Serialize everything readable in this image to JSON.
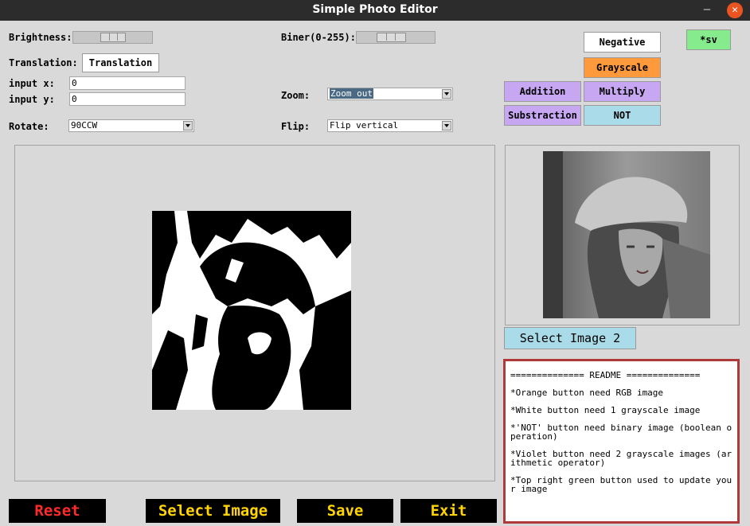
{
  "window": {
    "title": "Simple Photo Editor",
    "minimize_glyph": "–",
    "close_glyph": "✕"
  },
  "controls": {
    "brightness_label": "Brightness:",
    "biner_label": "Biner(0-255):",
    "translation_label": "Translation:",
    "translation_button": "Translation",
    "input_x_label": "input x:",
    "input_x_value": "0",
    "input_y_label": "input y:",
    "input_y_value": "0",
    "zoom_label": "Zoom:",
    "zoom_value": "Zoom out",
    "rotate_label": "Rotate:",
    "rotate_value": "90CCW",
    "flip_label": "Flip:",
    "flip_value": "Flip vertical"
  },
  "operations": {
    "negative": "Negative",
    "grayscale": "Grayscale",
    "addition": "Addition",
    "multiply": "Multiply",
    "subtraction": "Substraction",
    "not": "NOT",
    "save_small": "*sv"
  },
  "colors": {
    "orange": "#ff9a3c",
    "violet": "#c7a6f2",
    "cyan": "#a9dbe8",
    "green": "#86eb8c",
    "readme_border": "#b03a3a",
    "reset_text": "#ff2a2a",
    "action_text": "#ffd400"
  },
  "right_panel": {
    "select_image_2": "Select Image 2"
  },
  "readme": {
    "header": "============== README ==============",
    "lines": [
      "*Orange button need RGB image",
      "*White button need 1 grayscale image",
      "*'NOT' button need binary image (boolean operation)",
      "*Violet button need 2 grayscale images (arithmetic operator)",
      "*Top right green button used to update your image"
    ]
  },
  "bottom_bar": {
    "reset": "Reset",
    "select_image": "Select Image",
    "save": "Save",
    "exit": "Exit"
  }
}
